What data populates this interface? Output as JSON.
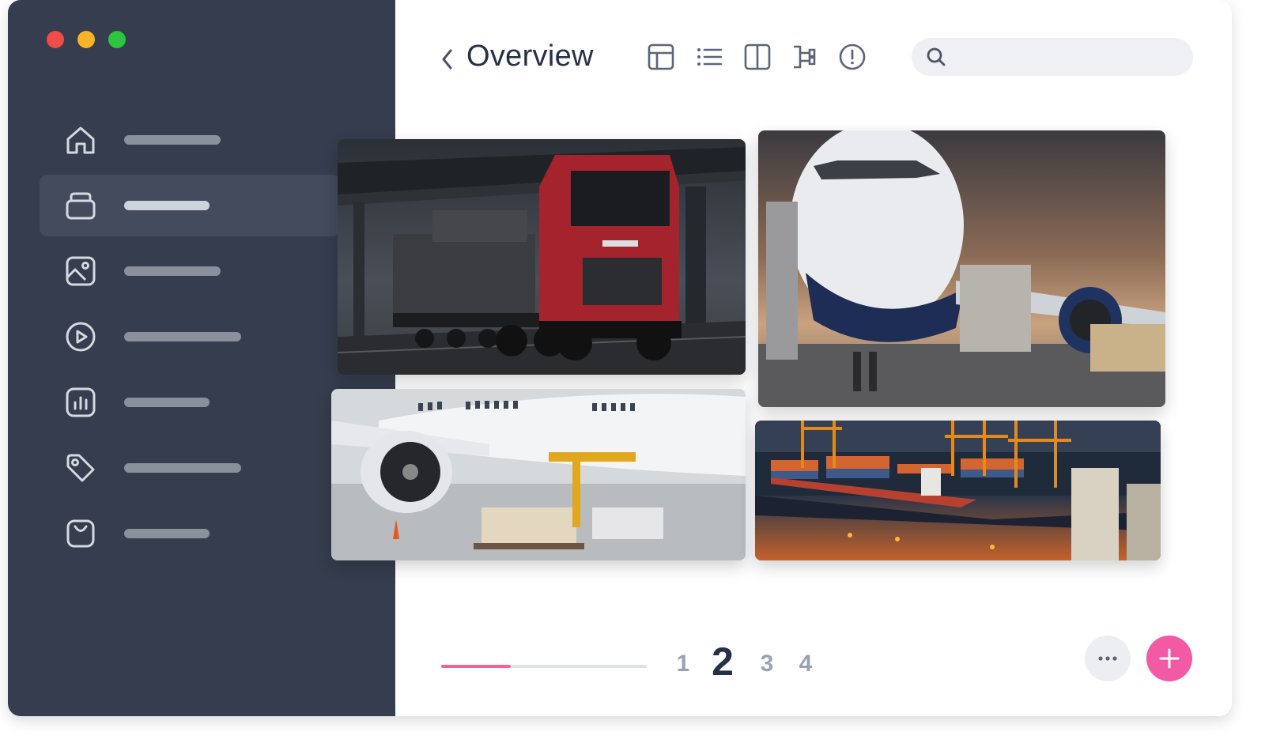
{
  "window": {
    "traffic_lights": [
      {
        "name": "close",
        "color": "#f04c48"
      },
      {
        "name": "minimize",
        "color": "#f6b426"
      },
      {
        "name": "maximize",
        "color": "#2ec43f"
      }
    ]
  },
  "sidebar": {
    "background": "#353d4e",
    "active_index": 1,
    "items": [
      {
        "icon": "home-icon"
      },
      {
        "icon": "box-icon"
      },
      {
        "icon": "image-icon"
      },
      {
        "icon": "play-circle-icon"
      },
      {
        "icon": "bar-chart-icon"
      },
      {
        "icon": "tag-icon"
      },
      {
        "icon": "shopping-bag-icon"
      }
    ]
  },
  "header": {
    "back_icon": "chevron-left-icon",
    "title": "Overview",
    "view_icons": [
      "table-icon",
      "list-icon",
      "columns-icon",
      "tree-icon",
      "alert-icon"
    ]
  },
  "search": {
    "icon": "search-icon",
    "value": "",
    "placeholder": ""
  },
  "gallery": {
    "photos": [
      {
        "name": "photo-red-truck",
        "subject": "truck"
      },
      {
        "name": "photo-cargo-plane-front",
        "subject": "plane-front"
      },
      {
        "name": "photo-plane-loading",
        "subject": "plane-side"
      },
      {
        "name": "photo-container-port",
        "subject": "port"
      }
    ]
  },
  "pagination": {
    "progress": 0.34,
    "pages": [
      "1",
      "2",
      "3",
      "4"
    ],
    "current_page": "2"
  },
  "actions": {
    "more_icon": "more-icon",
    "add_icon": "plus-icon",
    "accent": "#f25aa6"
  }
}
